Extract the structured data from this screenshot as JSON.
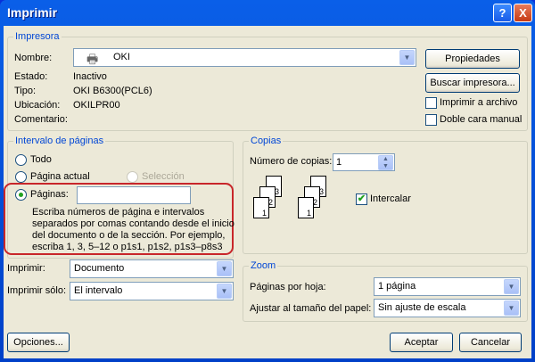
{
  "window": {
    "title": "Imprimir",
    "help_icon": "?",
    "close_icon": "X"
  },
  "printer": {
    "group_label": "Impresora",
    "name_label": "Nombre:",
    "name_value": "OKI",
    "status_label": "Estado:",
    "status_value": "Inactivo",
    "type_label": "Tipo:",
    "type_value": "OKI B6300(PCL6)",
    "location_label": "Ubicación:",
    "location_value": "OKILPR00",
    "comment_label": "Comentario:",
    "comment_value": "",
    "properties_button": "Propiedades",
    "find_button": "Buscar impresora...",
    "print_to_file": {
      "label": "Imprimir a archivo",
      "checked": false
    },
    "manual_duplex": {
      "label": "Doble cara manual",
      "checked": false
    }
  },
  "page_range": {
    "group_label": "Intervalo de páginas",
    "all": "Todo",
    "current": "Página actual",
    "selection": "Selección",
    "pages": "Páginas:",
    "pages_value": "",
    "selected": "pages",
    "help_lines": [
      "Escriba números de página e intervalos",
      "separados por comas contando desde el inicio",
      "del documento o de la sección. Por ejemplo,",
      "escriba 1, 3, 5–12 o p1s1, p1s2, p1s3–p8s3"
    ]
  },
  "copies": {
    "group_label": "Copias",
    "count_label": "Número de copias:",
    "count_value": "1",
    "collate": {
      "label": "Intercalar",
      "checked": true
    },
    "page_numbers": [
      "1",
      "2",
      "3"
    ]
  },
  "print_what": {
    "label": "Imprimir:",
    "value": "Documento"
  },
  "print_only": {
    "label": "Imprimir sólo:",
    "value": "El intervalo"
  },
  "zoom": {
    "group_label": "Zoom",
    "pages_per_sheet_label": "Páginas por hoja:",
    "pages_per_sheet_value": "1 página",
    "scale_label": "Ajustar al tamaño del papel:",
    "scale_value": "Sin ajuste de escala"
  },
  "buttons": {
    "options": "Opciones...",
    "ok": "Aceptar",
    "cancel": "Cancelar"
  }
}
